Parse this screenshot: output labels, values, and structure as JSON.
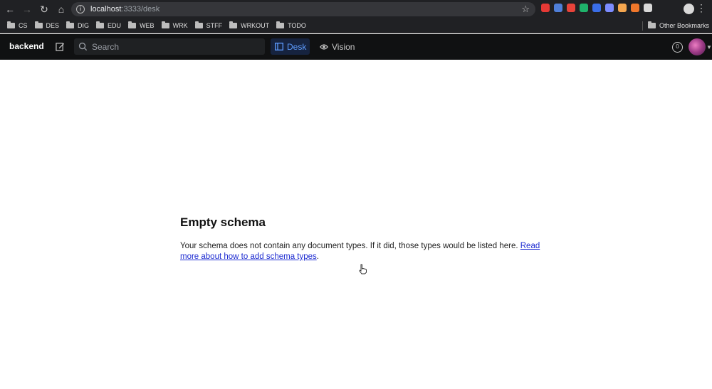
{
  "browser": {
    "url_host": "localhost",
    "url_path": ":3333/desk",
    "bookmarks": [
      "CS",
      "DES",
      "DIG",
      "EDU",
      "WEB",
      "WRK",
      "STFF",
      "WRKOUT",
      "TODO"
    ],
    "other_bookmarks": "Other Bookmarks",
    "extension_colors": [
      "#e53935",
      "#4f7fd9",
      "#e8433a",
      "#1fb36b",
      "#3a6ee8",
      "#7c8cff",
      "#f4a64f",
      "#f0772b",
      "#d8d8d8"
    ]
  },
  "app": {
    "brand": "backend",
    "search_placeholder": "Search",
    "tabs": [
      {
        "label": "Desk",
        "active": true,
        "icon": "desk-icon"
      },
      {
        "label": "Vision",
        "active": false,
        "icon": "eye-icon"
      }
    ],
    "status_count": "0"
  },
  "content": {
    "title": "Empty schema",
    "body": "Your schema does not contain any document types. If it did, those types would be listed here. ",
    "link": "Read more about how to add schema types",
    "trailing": "."
  }
}
